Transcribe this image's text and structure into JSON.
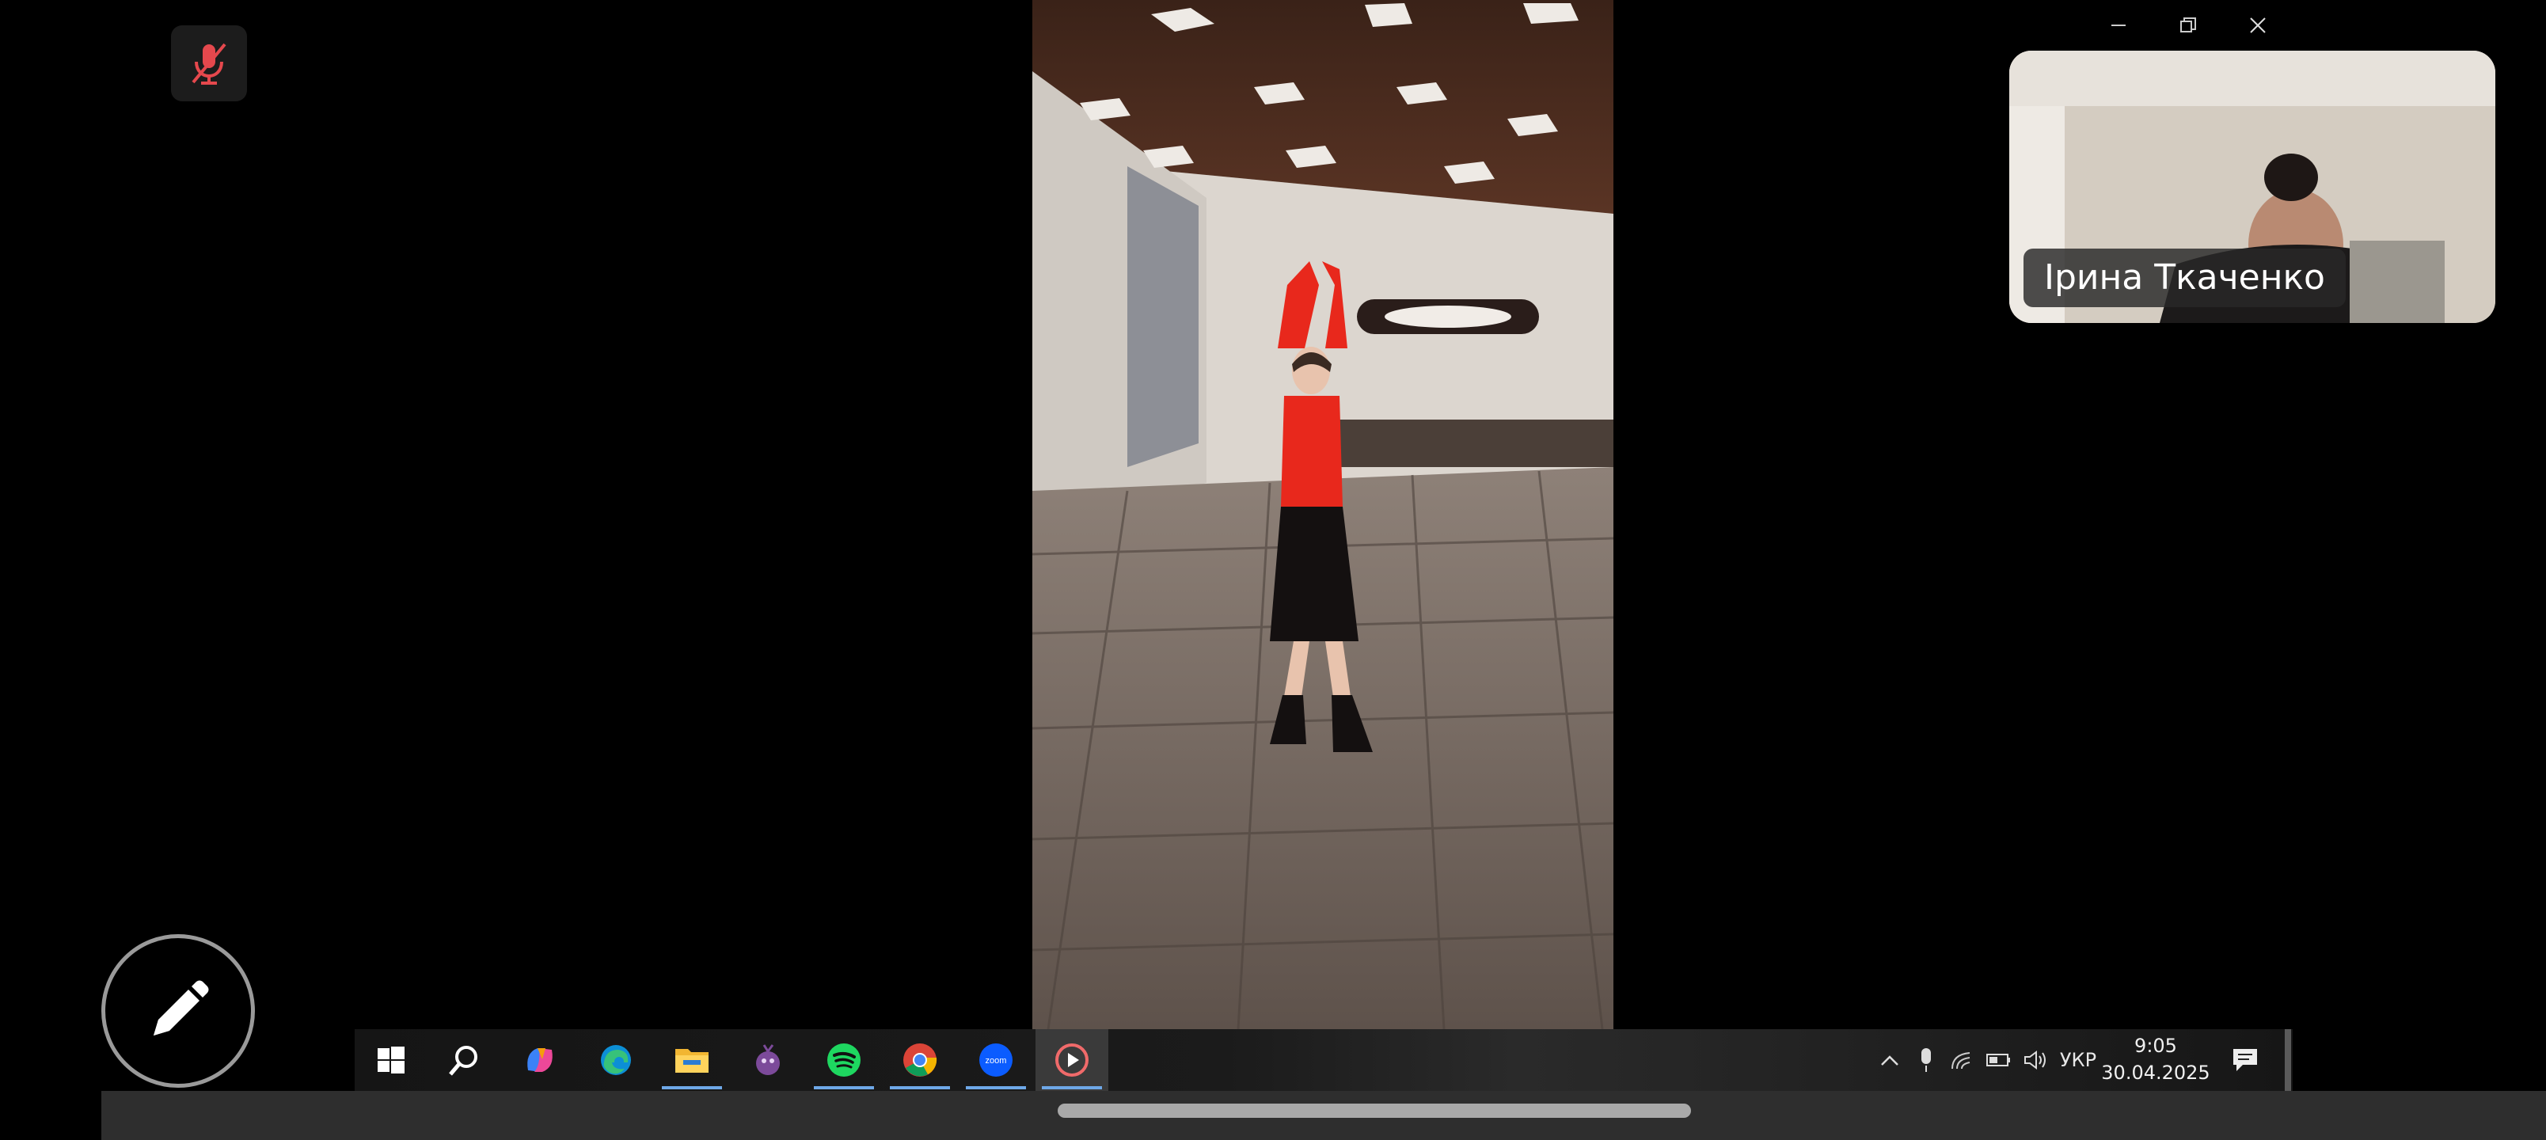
{
  "participant": {
    "name": "Ірина Ткаченко"
  },
  "taskbar": {
    "icons": [
      {
        "name": "windows-start-icon"
      },
      {
        "name": "search-icon"
      },
      {
        "name": "copilot-icon"
      },
      {
        "name": "edge-icon"
      },
      {
        "name": "file-explorer-icon"
      },
      {
        "name": "media-app-icon"
      },
      {
        "name": "spotify-icon"
      },
      {
        "name": "chrome-icon"
      },
      {
        "name": "zoom-icon",
        "label": "zoom"
      },
      {
        "name": "media-player-icon"
      }
    ],
    "tray": {
      "language": "УКР",
      "time": "9:05",
      "date": "30.04.2025"
    }
  },
  "colors": {
    "accent_running": "#6ea8e8",
    "mic_muted": "#e5484d",
    "zoom_blue": "#0b5cff"
  }
}
